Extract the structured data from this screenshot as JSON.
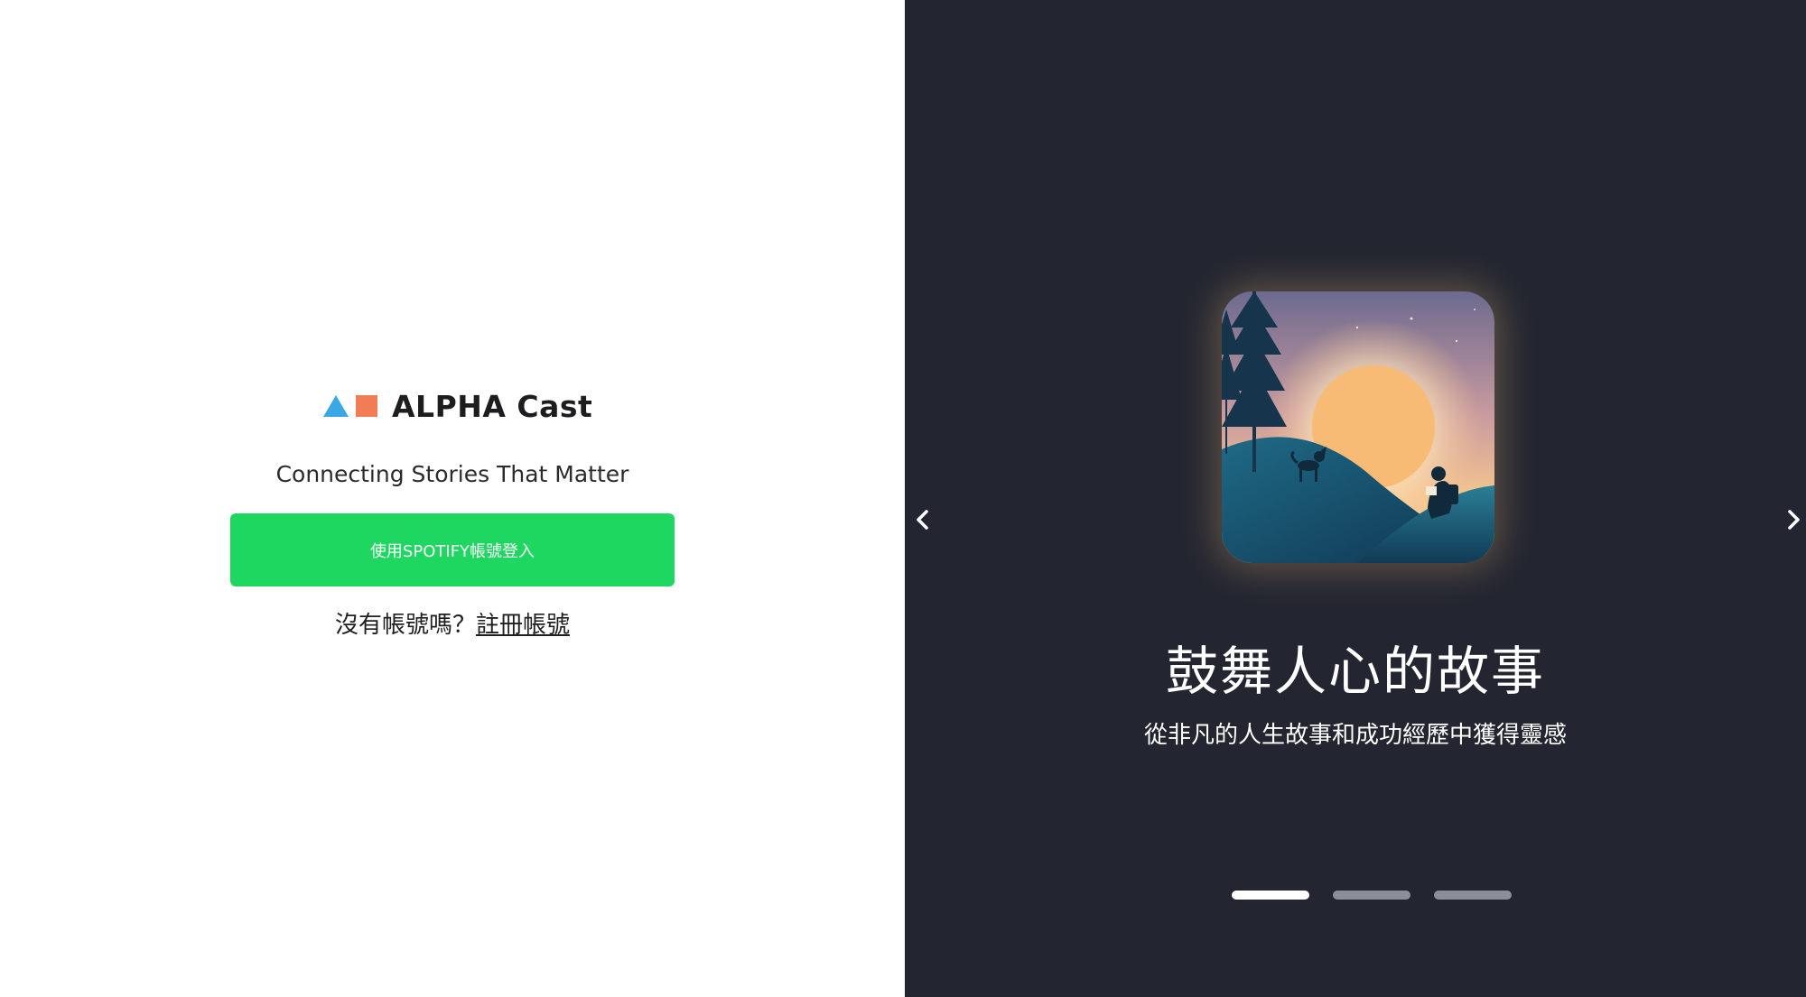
{
  "brand": {
    "name": "ALPHA Cast",
    "tagline": "Connecting Stories That Matter",
    "colors": {
      "triangle": "#3aa7e6",
      "square": "#f07d55"
    }
  },
  "login": {
    "spotify_button_label": "使用SPOTIFY帳號登入",
    "no_account_prompt": "沒有帳號嗎？",
    "signup_link_label": "註冊帳號"
  },
  "carousel": {
    "prev_icon": "chevron-left-icon",
    "next_icon": "chevron-right-icon",
    "slide": {
      "title": "鼓舞人心的故事",
      "subtitle": "從非凡的人生故事和成功經歷中獲得靈感",
      "image": "sunset-reading-illustration"
    },
    "slide_count": 3,
    "active_index": 0
  },
  "colors": {
    "accent_green": "#1ed760",
    "right_panel_bg": "#232630"
  }
}
